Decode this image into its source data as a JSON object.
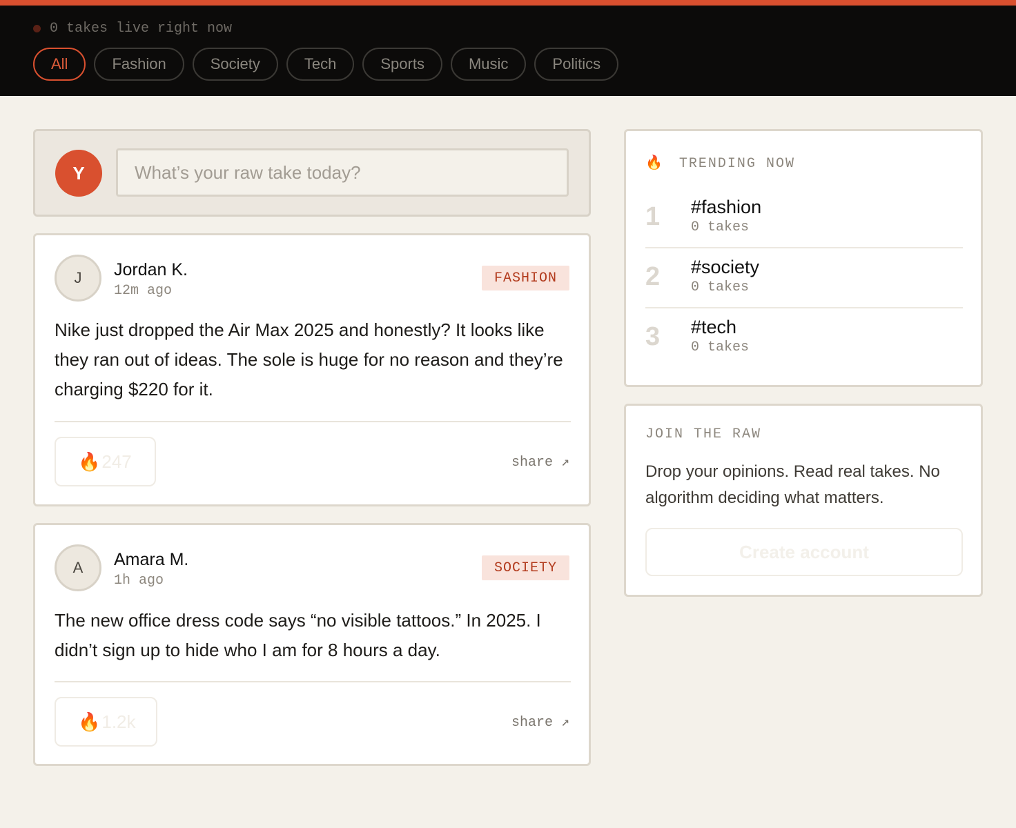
{
  "header": {
    "live_text": "0 takes live right now",
    "categories": [
      "All",
      "Fashion",
      "Society",
      "Tech",
      "Sports",
      "Music",
      "Politics"
    ],
    "active_category": "All"
  },
  "composer": {
    "avatar_initial": "Y",
    "placeholder": "What’s your raw take today?"
  },
  "posts": [
    {
      "avatar_initial": "J",
      "author": "Jordan K.",
      "time": "12m ago",
      "tag": "FASHION",
      "body": "Nike just dropped the Air Max 2025 and honestly? It looks like they ran out of ideas. The sole is huge for no reason and they’re charging $220 for it.",
      "reaction_icon": "fire-icon",
      "reaction_glyph": "🔥",
      "reaction_count": "247",
      "share_label": "share ↗"
    },
    {
      "avatar_initial": "A",
      "author": "Amara M.",
      "time": "1h ago",
      "tag": "SOCIETY",
      "body": "The new office dress code says “no visible tattoos.” In 2025. I didn’t sign up to hide who I am for 8 hours a day.",
      "reaction_icon": "fire-icon",
      "reaction_glyph": "🔥",
      "reaction_count": "1.2k",
      "share_label": "share ↗"
    }
  ],
  "trending": {
    "icon": "fire-icon",
    "icon_glyph": "🔥",
    "heading": "TRENDING NOW",
    "items": [
      {
        "rank": "1",
        "tag": "#fashion",
        "count": "0 takes"
      },
      {
        "rank": "2",
        "tag": "#society",
        "count": "0 takes"
      },
      {
        "rank": "3",
        "tag": "#tech",
        "count": "0 takes"
      }
    ]
  },
  "join": {
    "heading": "JOIN THE RAW",
    "text": "Drop your opinions. Read real takes. No algorithm deciding what matters.",
    "button_label": "Create account"
  },
  "colors": {
    "accent": "#d9502f",
    "topbar_bg": "#0c0b0a",
    "page_bg": "#f4f1ea",
    "tag_bg": "#f9e3dc",
    "tag_text": "#b23a1c"
  }
}
